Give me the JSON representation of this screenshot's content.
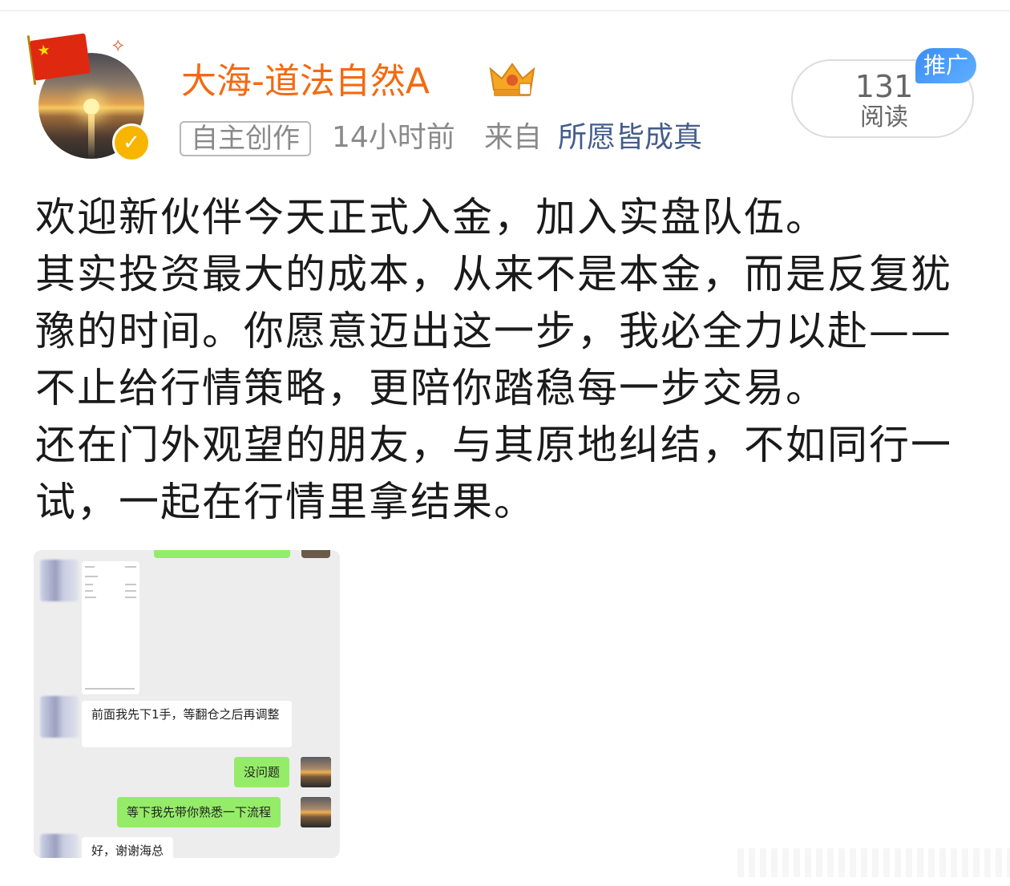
{
  "post": {
    "username": "大海-道法自然A",
    "source_tag": "自主创作",
    "time": "14小时前",
    "from_label": "来自",
    "from_link": "所愿皆成真",
    "read_count": "131",
    "read_label": "阅读",
    "promo_badge": "推广",
    "paragraphs": [
      "欢迎新伙伴今天正式入金，加入实盘队伍。",
      "其实投资最大的成本，从来不是本金，而是反复犹豫的时间。你愿意迈出这一步，我必全力以赴——不止给行情策略，更陪你踏稳每一步交易。",
      "还在门外观望的朋友，与其原地纠结，不如同行一试，一起在行情里拿结果。"
    ]
  },
  "chat": {
    "messages": [
      {
        "side": "left",
        "text": "前面我先下1手，等翻仓之后再调整"
      },
      {
        "side": "right",
        "text": "没问题"
      },
      {
        "side": "right",
        "text": "等下我先带你熟悉一下流程"
      },
      {
        "side": "left",
        "text": "好，谢谢海总"
      }
    ]
  },
  "icons": {
    "verified": "v-badge-icon",
    "crown": "crown-level-icon",
    "flag": "china-flag-icon"
  },
  "colors": {
    "username": "#f26a13",
    "link": "#445d8b",
    "promo": "#3b8cf5",
    "chat_green": "#95ec69"
  }
}
